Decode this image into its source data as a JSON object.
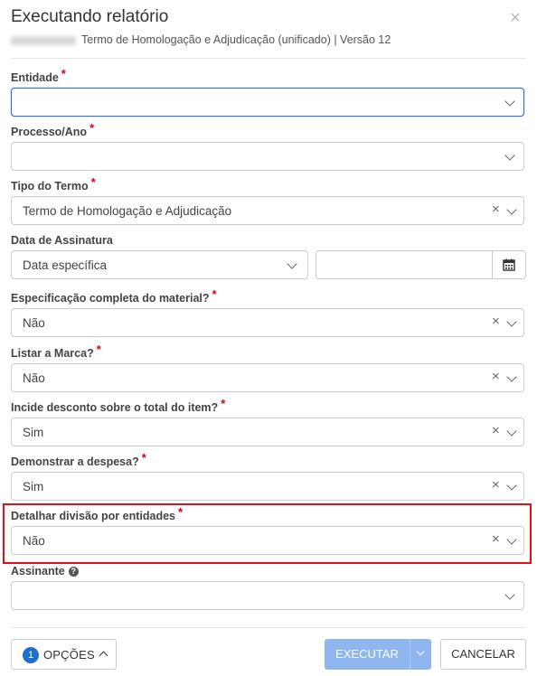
{
  "dialog": {
    "title": "Executando relatório",
    "close_label": "×",
    "subtitle": "Termo de Homologação e Adjudicação (unificado) | Versão 12"
  },
  "fields": {
    "entidade": {
      "label": "Entidade",
      "required": "*",
      "value": ""
    },
    "processo": {
      "label": "Processo/Ano",
      "required": "*",
      "value": ""
    },
    "tipo_termo": {
      "label": "Tipo do Termo",
      "required": "*",
      "value": "Termo de Homologação e Adjudicação"
    },
    "data_assinatura": {
      "label": "Data de Assinatura",
      "select_value": "Data específica",
      "date_value": ""
    },
    "especificacao": {
      "label": "Especificação completa do material?",
      "required": "*",
      "value": "Não"
    },
    "marca": {
      "label": "Listar a Marca?",
      "required": "*",
      "value": "Não"
    },
    "desconto": {
      "label": "Incide desconto sobre o total do item?",
      "required": "*",
      "value": "Sim"
    },
    "despesa": {
      "label": "Demonstrar a despesa?",
      "required": "*",
      "value": "Sim"
    },
    "divisao": {
      "label": "Detalhar divisão por entidades",
      "required": "*",
      "value": "Não"
    },
    "assinante": {
      "label": "Assinante",
      "help": "?",
      "value": ""
    }
  },
  "footer": {
    "options_count": "1",
    "options_label": "OPÇÕES",
    "execute_label": "EXECUTAR",
    "cancel_label": "CANCELAR"
  },
  "icons": {
    "clear": "×",
    "calendar": "calendar-icon"
  },
  "colors": {
    "accent": "#1f6fd0",
    "execute_disabled": "#8fb6ee",
    "required": "#d0021b",
    "highlight": "#e0111a"
  }
}
